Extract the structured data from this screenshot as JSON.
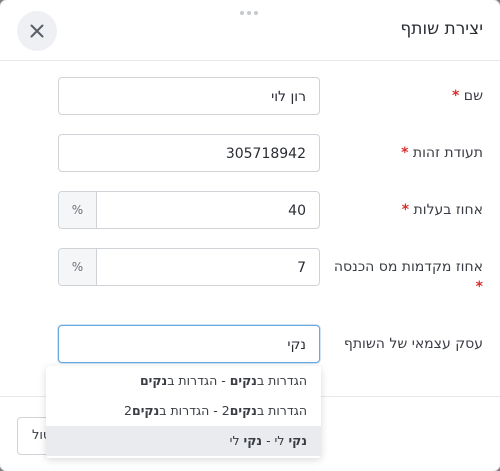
{
  "dialog": {
    "title": "יצירת שותף",
    "close_icon": "close-icon"
  },
  "fields": {
    "name": {
      "label": "שם",
      "required_mark": "*",
      "value": "רון לוי"
    },
    "id_number": {
      "label": "תעודת זהות",
      "required_mark": "*",
      "value": "305718942"
    },
    "ownership": {
      "label": "אחוז בעלות",
      "required_mark": "*",
      "value": "40",
      "suffix": "%"
    },
    "tax_advance": {
      "label": "אחוז מקדמות מס הכנסה",
      "required_mark": "*",
      "value": "7",
      "suffix": "%"
    },
    "business": {
      "label": "עסק עצמאי של השותף",
      "value": "נקי"
    }
  },
  "dropdown": {
    "options": [
      {
        "pre": "הגדרות ב",
        "match": "נקים",
        "post": " - הגדרות ב",
        "match2": "נקים",
        "tail": ""
      },
      {
        "pre": "הגדרות ב",
        "match": "נקים",
        "post": "2 - הגדרות ב",
        "match2": "נקים",
        "tail": "2"
      },
      {
        "pre": "",
        "match": "נקי",
        "post": " לי - ",
        "match2": "נקי",
        "tail": " לי"
      }
    ],
    "active_index": 2
  },
  "footer": {
    "cancel_label": "ביטול"
  }
}
